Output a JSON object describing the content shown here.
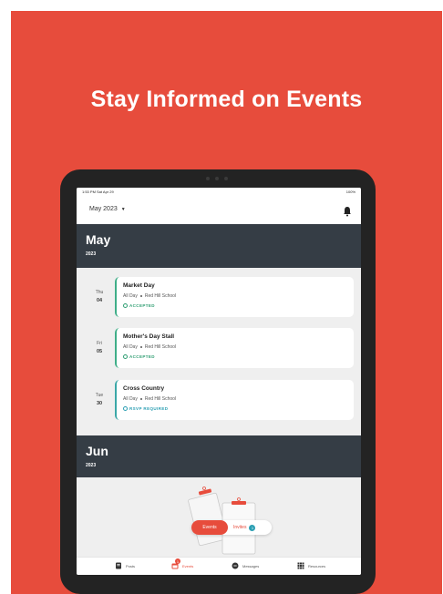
{
  "headline": "Stay Informed on Events",
  "status_bar": {
    "time": "1:53 PM  Sat Apr 29",
    "battery": "100%"
  },
  "header": {
    "month_selector": "May 2023"
  },
  "sections": [
    {
      "month": "May",
      "year": "2023",
      "events": [
        {
          "weekday": "Thu",
          "day": "04",
          "title": "Market Day",
          "when": "All Day",
          "location": "Red Hill School",
          "status": "ACCEPTED"
        },
        {
          "weekday": "Fri",
          "day": "05",
          "title": "Mother's Day Stall",
          "when": "All Day",
          "location": "Red Hill School",
          "status": "ACCEPTED"
        },
        {
          "weekday": "Tue",
          "day": "30",
          "title": "Cross Country",
          "when": "All Day",
          "location": "Red Hill School",
          "status": "RSVP REQUIRED"
        }
      ]
    },
    {
      "month": "Jun",
      "year": "2023",
      "events": []
    }
  ],
  "toggle": {
    "events_label": "Events",
    "invites_label": "Invites",
    "invites_badge": "1"
  },
  "tabbar": {
    "posts": "Posts",
    "events": "Events",
    "events_badge": "1",
    "messages": "Messages",
    "resources": "Resources"
  },
  "colors": {
    "brand_red": "#e74c3c",
    "banner": "#353d45",
    "accepted_green": "#2f9e72",
    "rsvp_teal": "#2c9fb3"
  },
  "icons": [
    "bell-icon",
    "posts-icon",
    "calendar-icon",
    "message-icon",
    "grid-icon",
    "check-circle-icon"
  ]
}
